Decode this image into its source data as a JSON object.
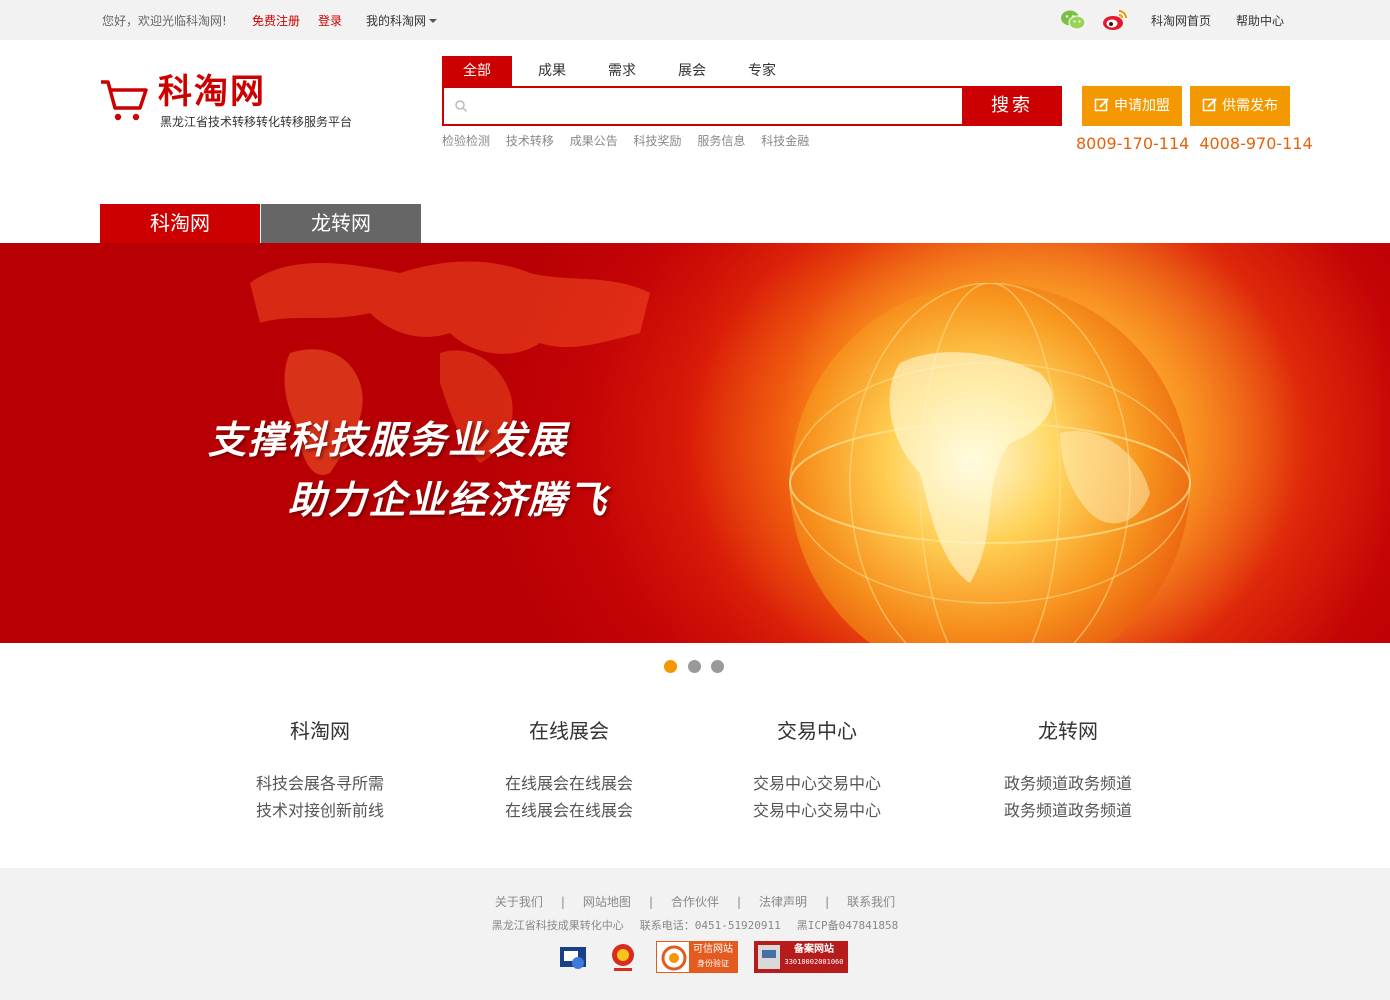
{
  "topbar": {
    "greeting": "您好，欢迎光临科淘网!",
    "register": "免费注册",
    "login": "登录",
    "my_site": "我的科淘网",
    "home_link": "科淘网首页",
    "help_link": "帮助中心"
  },
  "logo": {
    "name": "科淘网",
    "subtitle": "黑龙江省技术转移转化转移服务平台"
  },
  "search": {
    "tabs": [
      "全部",
      "成果",
      "需求",
      "展会",
      "专家"
    ],
    "active_tab": "全部",
    "placeholder": "",
    "button": "搜索",
    "hot_words": [
      "检验检测",
      "技术转移",
      "成果公告",
      "科技奖励",
      "服务信息",
      "科技金融"
    ]
  },
  "actions": {
    "join": "申请加盟",
    "publish": "供需发布",
    "phones": [
      "8009-170-114",
      "4008-970-114"
    ]
  },
  "site_tabs": [
    "科淘网",
    "龙转网"
  ],
  "banner": {
    "slogan1": "支撑科技服务业发展",
    "slogan2": "助力企业经济腾飞",
    "slide_count": 3,
    "active_slide": 1
  },
  "columns": [
    {
      "title": "科淘网",
      "lines": [
        "科技会展各寻所需",
        "技术对接创新前线"
      ]
    },
    {
      "title": "在线展会",
      "lines": [
        "在线展会在线展会",
        "在线展会在线展会"
      ]
    },
    {
      "title": "交易中心",
      "lines": [
        "交易中心交易中心",
        "交易中心交易中心"
      ]
    },
    {
      "title": "龙转网",
      "lines": [
        "政务频道政务频道",
        "政务频道政务频道"
      ]
    }
  ],
  "footer": {
    "links": [
      "关于我们",
      "网站地图",
      "合作伙伴",
      "法律声明",
      "联系我们"
    ],
    "org": "黑龙江省科技成果转化中心",
    "phone": "联系电话：0451-51920911",
    "icp": "黑ICP备047841858",
    "badges": {
      "trusted": "可信网站",
      "trusted_sub": "身份验证",
      "record": "备案网站",
      "record_no": "33010002001060"
    }
  },
  "colors": {
    "brand_red": "#cc0000",
    "accent_orange": "#f39800",
    "phone_orange": "#e8600a",
    "tab_gray": "#666666"
  }
}
